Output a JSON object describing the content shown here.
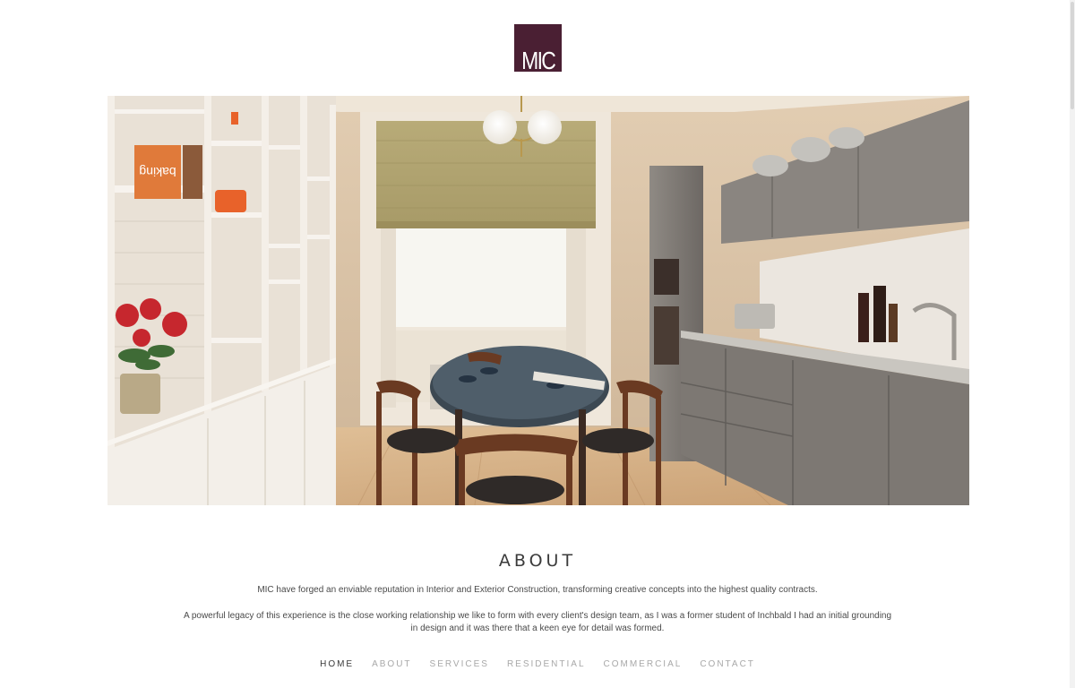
{
  "logo": {
    "text": "MIC",
    "background": "#4a1f33"
  },
  "hero": {
    "image_subject": "kitchen-dining-interior",
    "book_spine_text": "baking"
  },
  "about": {
    "title": "ABOUT",
    "paragraph1": "MIC have forged an enviable reputation in Interior and Exterior Construction, transforming creative concepts into the highest quality contracts.",
    "paragraph2": "A powerful legacy of this experience is the close working relationship we like to form with every client's design team, as I was a former student of Inchbald I had an initial grounding in design and it was there that a keen eye for detail was formed."
  },
  "nav": {
    "items": [
      {
        "label": "HOME",
        "active": true
      },
      {
        "label": "ABOUT",
        "active": false
      },
      {
        "label": "SERVICES",
        "active": false
      },
      {
        "label": "RESIDENTIAL",
        "active": false
      },
      {
        "label": "COMMERCIAL",
        "active": false
      },
      {
        "label": "CONTACT",
        "active": false
      }
    ]
  },
  "colors": {
    "brand": "#4a1f33",
    "nav_active": "#3a3a3a",
    "nav_inactive": "#a8a8a8"
  }
}
